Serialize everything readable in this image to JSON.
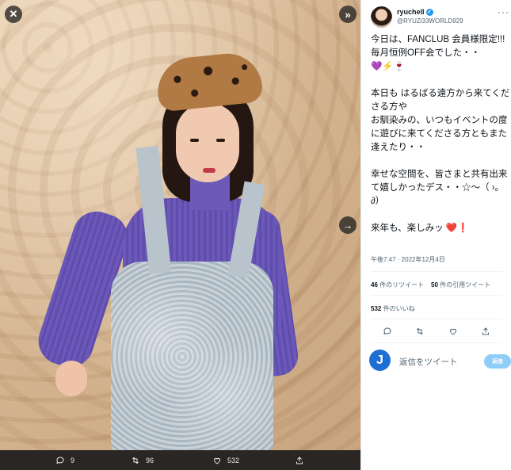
{
  "viewer": {
    "close_icon": "close-icon",
    "expand_icon": "double-chevron-right-icon",
    "next_icon": "arrow-right-icon",
    "actions": {
      "replies": "9",
      "retweets": "96",
      "likes": "532"
    }
  },
  "panel": {
    "user": {
      "name": "ryuchell",
      "handle": "@RYUZi33WORLD929"
    },
    "more_label": "···",
    "tweet": {
      "paragraphs": [
        "今日は、FANCLUB 会員様限定!!!\n毎月恒例OFF会でした・・\n💜⚡🍷",
        "本日も はるばる遠方から来てくださる方や\nお馴染みの、いつもイベントの度に遊びに来てくださる方ともまた逢えたり・・",
        "幸せな空間を、皆さまと共有出来て嬉しかったデス・・☆〜（ ›。∂）",
        "来年も、楽しみッ ❤️❗"
      ]
    },
    "timestamp": "午後7:47 · 2022年12月4日",
    "stats": {
      "retweets_count": "46",
      "retweets_label": " 件のリツイート",
      "quotes_count": "50",
      "quotes_label": " 件の引用ツイート",
      "likes_count": "532",
      "likes_label": " 件のいいね"
    },
    "reply": {
      "avatar_letter": "J",
      "placeholder": "返信をツイート",
      "button_label": "返信"
    }
  },
  "colors": {
    "accent": "#1d9bf0",
    "reply_button": "#8ecdf8",
    "viewer_bg": "#2a2623"
  }
}
